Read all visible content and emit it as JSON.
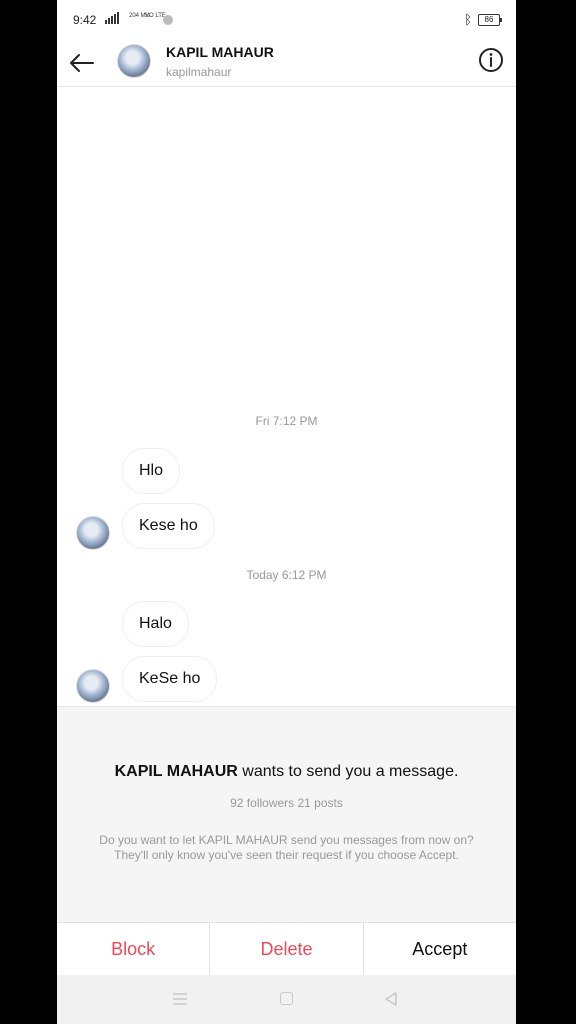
{
  "status_bar": {
    "time": "9:42",
    "network_a": "204 M/s",
    "network_b": "VO LTE",
    "battery": "86"
  },
  "header": {
    "name": "KAPIL MAHAUR",
    "username": "kapilmahaur"
  },
  "messages": [
    {
      "type": "timestamp",
      "text": "Fri 7:12 PM"
    },
    {
      "type": "bubble",
      "text": "Hlo"
    },
    {
      "type": "bubble",
      "text": "Kese ho"
    },
    {
      "type": "timestamp",
      "text": "Today 6:12 PM"
    },
    {
      "type": "bubble",
      "text": "Halo"
    },
    {
      "type": "bubble",
      "text": "KeSe ho"
    }
  ],
  "request": {
    "sender": "KAPIL MAHAUR",
    "title_suffix": "wants to send you a message.",
    "stats": "92 followers 21 posts",
    "description": "Do you want to let KAPIL MAHAUR send you messages from now on? They'll only know you've seen their request if you choose Accept."
  },
  "actions": {
    "block": "Block",
    "delete": "Delete",
    "accept": "Accept"
  },
  "colors": {
    "danger": "#ed4956",
    "muted": "#999999"
  }
}
